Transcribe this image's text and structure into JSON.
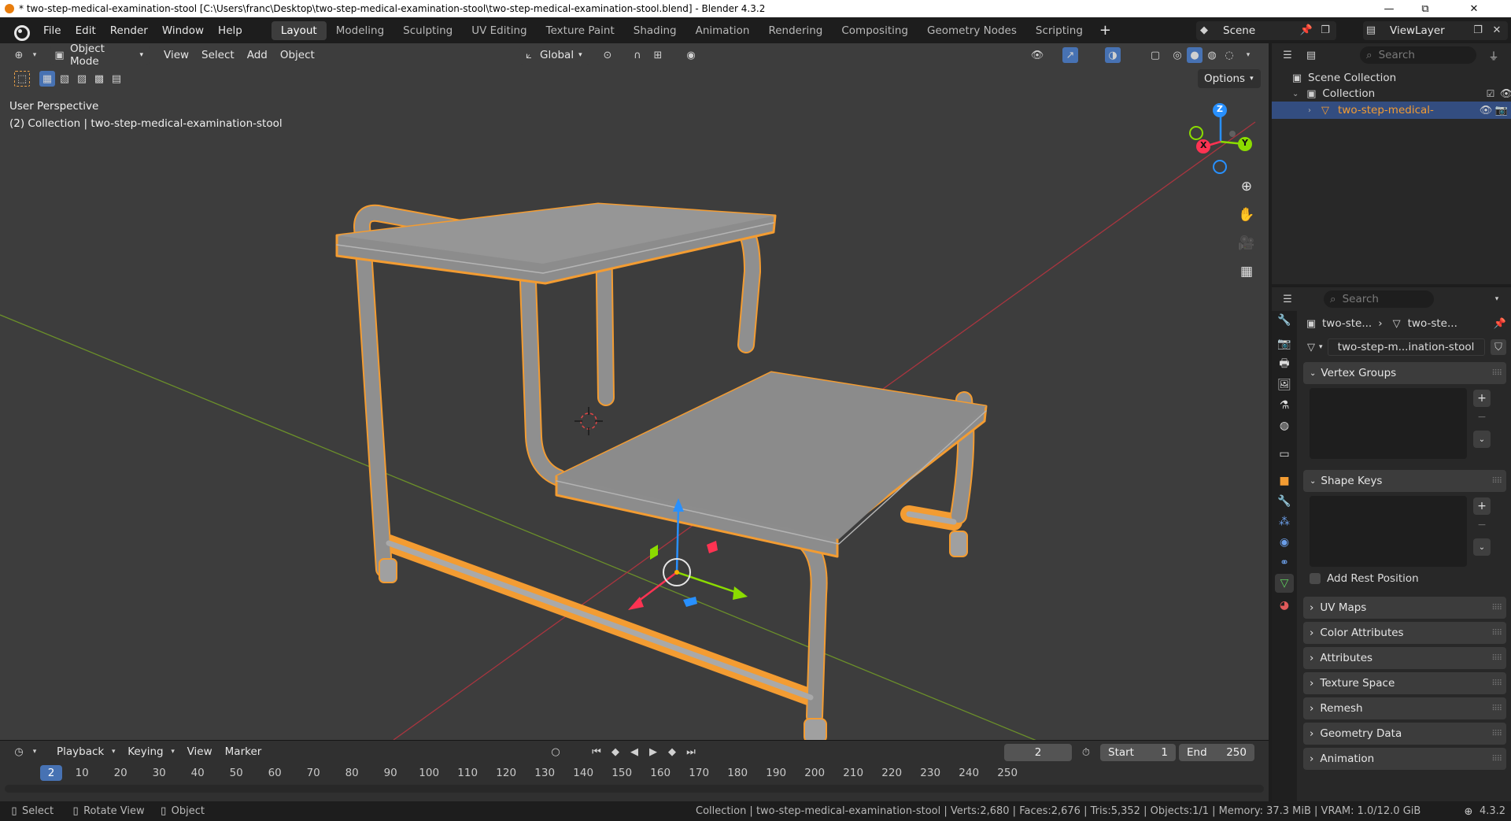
{
  "window": {
    "title": "* two-step-medical-examination-stool [C:\\Users\\franc\\Desktop\\two-step-medical-examination-stool\\two-step-medical-examination-stool.blend] - Blender 4.3.2",
    "minimize": "—",
    "maximize": "⧉",
    "close": "✕"
  },
  "menus": [
    "File",
    "Edit",
    "Render",
    "Window",
    "Help"
  ],
  "workspaces": {
    "active": "Layout",
    "tabs": [
      "Layout",
      "Modeling",
      "Sculpting",
      "UV Editing",
      "Texture Paint",
      "Shading",
      "Animation",
      "Rendering",
      "Compositing",
      "Geometry Nodes",
      "Scripting"
    ],
    "add": "+"
  },
  "scene": {
    "name": "Scene",
    "view_layer": "ViewLayer"
  },
  "viewport": {
    "mode": "Object Mode",
    "menus": [
      "View",
      "Select",
      "Add",
      "Object"
    ],
    "orientation": "Global",
    "options": "Options",
    "perspective_label": "User Perspective",
    "collection_label": "(2) Collection | two-step-medical-examination-stool",
    "gizmo_axes": {
      "x": "X",
      "y": "Y",
      "z": "Z"
    }
  },
  "outliner": {
    "search_placeholder": "Search",
    "scene_collection": "Scene Collection",
    "collection": "Collection",
    "object": "two-step-medical-"
  },
  "properties": {
    "search_placeholder": "Search",
    "breadcrumb_object": "two-ste...",
    "breadcrumb_mesh": "two-ste...",
    "mesh_name": "two-step-m...ination-stool",
    "panels": {
      "vertex_groups": "Vertex Groups",
      "shape_keys": "Shape Keys",
      "add_rest_position": "Add Rest Position",
      "uv_maps": "UV Maps",
      "color_attributes": "Color Attributes",
      "attributes": "Attributes",
      "texture_space": "Texture Space",
      "remesh": "Remesh",
      "geometry_data": "Geometry Data",
      "animation": "Animation"
    }
  },
  "timeline": {
    "menus": [
      "Playback",
      "Keying",
      "View",
      "Marker"
    ],
    "current_frame": "2",
    "start_label": "Start",
    "start": "1",
    "end_label": "End",
    "end": "250",
    "ticks": [
      "2",
      "10",
      "20",
      "30",
      "40",
      "50",
      "60",
      "70",
      "80",
      "90",
      "100",
      "110",
      "120",
      "130",
      "140",
      "150",
      "160",
      "170",
      "180",
      "190",
      "200",
      "210",
      "220",
      "230",
      "240",
      "250"
    ]
  },
  "statusbar": {
    "select": "Select",
    "rotate": "Rotate View",
    "object": "Object",
    "stats": "Collection | two-step-medical-examination-stool | Verts:2,680 | Faces:2,676 | Tris:5,352 | Objects:1/1 | Memory: 37.3 MiB | VRAM: 1.0/12.0 GiB",
    "version": "4.3.2"
  },
  "colors": {
    "accent": "#4772b3",
    "selection_outline": "#f39c32",
    "viewport_bg": "#3d3d3d",
    "axis_x": "#ff3352",
    "axis_y": "#8bdc00",
    "axis_z": "#2890ff"
  }
}
